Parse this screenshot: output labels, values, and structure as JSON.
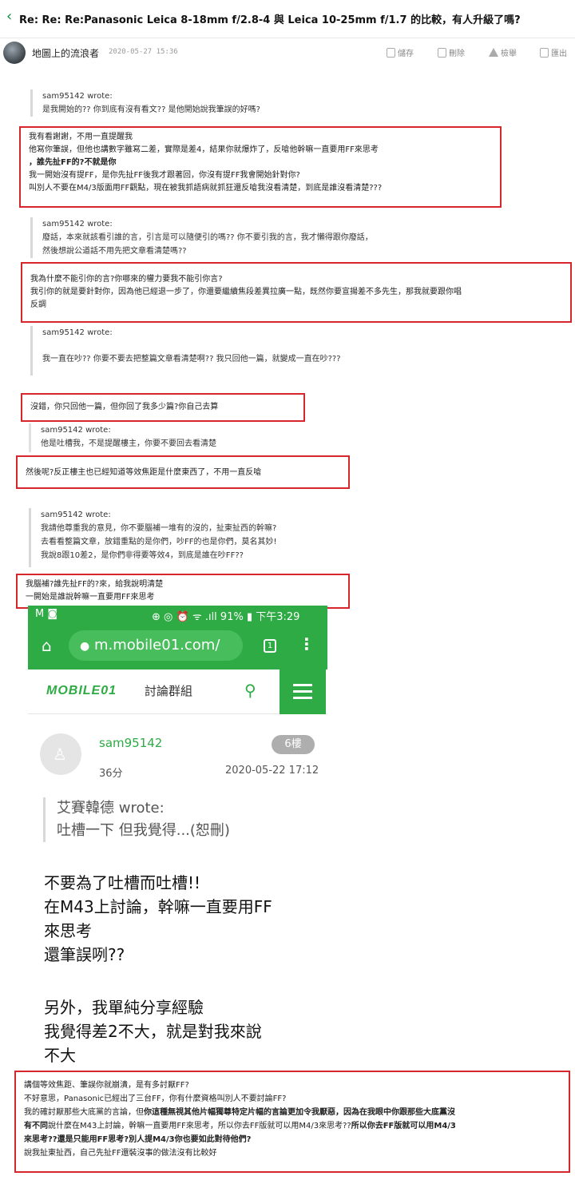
{
  "header": {
    "back_glyph": "‹",
    "title": "Re: Re: Re:Panasonic Leica 8-18mm f/2.8-4 與 Leica 10-25mm f/1.7 的比較，有人升級了嗎?"
  },
  "author": {
    "name": "地圖上的流浪者",
    "time": "2020-05-27 15:36"
  },
  "actions": {
    "save": "儲存",
    "delete": "刪除",
    "report": "檢舉",
    "export": "匯出"
  },
  "quote1": {
    "author": "sam95142 wrote:",
    "text": "是我開始的?? 你到底有沒有看文?? 是他開始說我筆誤的好嗎?"
  },
  "reply1": {
    "line1": "我有看謝謝，不用一直提醒我",
    "line2": "他寫你筆誤，但他也講數字雖寫二差，實際是差4，結果你就爆炸了，反嗆他幹嘛一直要用FF來思考",
    "line3": "，誰先扯FF的?不就是你",
    "line4": "我一開始沒有提FF，是你先扯FF後我才跟著回，你沒有提FF我會開始針對你?",
    "line5": "叫別人不要在M4/3版面用FF觀點，現在被我抓語病就抓狂還反嗆我沒看清楚，到底是誰沒看清楚???"
  },
  "quote2": {
    "author": "sam95142 wrote:",
    "line1": "廢話，本來就該看引誰的言，引言是可以隨便引的嗎?? 你不要引我的言，我才懶得跟你廢話，",
    "line2": "然後想說公道話不用先把文章看清楚嗎??"
  },
  "reply2": {
    "line1": "我為什麼不能引你的言?你哪來的權力要我不能引你言?",
    "line2": "我引你的就是要針對你，因為他已經退一步了，你還要繼續焦段差異拉廣一點，既然你要宣揚差不多先生，那我就要跟你唱",
    "line3": "反調"
  },
  "quote3": {
    "author": "sam95142 wrote:",
    "text": "我一直在吵?? 你要不要去把整篇文章看清楚啊?? 我只回他一篇，就變成一直在吵???"
  },
  "reply3": {
    "text": "沒錯，你只回他一篇，但你回了我多少篇?你自己去算"
  },
  "quote4": {
    "author": "sam95142 wrote:",
    "text": "他是吐槽我，不是提醒樓主，你要不要回去看清楚"
  },
  "reply4": {
    "text": "然後呢?反正樓主也已經知道等效焦距是什麼東西了，不用一直反嗆"
  },
  "quote5": {
    "author": "sam95142 wrote:",
    "line1": "我請他尊重我的意見，你不要腦補一堆有的沒的，扯東扯西的幹嘛?",
    "line2": "去看看整篇文章，放錯重點的是你們，吵FF的也是你們，莫名其妙!",
    "line3": "我說8跟10差2，是你們非得要等效4，到底是誰在吵FF??"
  },
  "reply5": {
    "line1": "我腦補?誰先扯FF的?來，給我說明清楚",
    "line2": "一開始是誰說幹嘛一直要用FF來思考"
  },
  "phone": {
    "status_left": "M ◙",
    "status_right": "⊕ ◎ ⏰ ᯤ .ıll 91% ▮ 下午3:29",
    "url": "m.mobile01.com/",
    "tab_count": "1",
    "logo": "MOBILE01",
    "forum_label": "討論群組",
    "post_user": "sam95142",
    "floor": "6樓",
    "post_age": "36分",
    "post_date": "2020-05-22 17:12",
    "quote_author": "艾賽韓德 wrote:",
    "quote_text": "吐槽一下 但我覺得...(恕刪)",
    "body": [
      "不要為了吐槽而吐槽!!",
      "在M43上討論，幹嘛一直要用FF",
      "來思考",
      "還筆誤咧??",
      "",
      "另外，我單純分享經驗",
      "我覺得差2不大，就是對我來說",
      "不大"
    ]
  },
  "reply6": {
    "line1": "講個等效焦距、筆誤你就崩潰，是有多討厭FF?",
    "line2": "不好意思，Panasonic已經出了三台FF，你有什麼資格叫別人不要討論FF?",
    "line3a": "我的確討厭那些大底黨的言論，但",
    "line3b": "你這種無視其他片幅獨尊特定片幅的言論更加令我厭惡，因為在我眼中你跟那些大底黨沒",
    "line4a": "有不同",
    "line4b": "說什麼在M43上討論，幹嘛一直要用FF來思考，所以你去FF版就可以用M4/3來思考??",
    "line4c": "所以你去FF版就可以用M4/3",
    "line5": "來思考??還是只能用FF思考?別人提M4/3你也要如此對待他們?",
    "line6": "說我扯東扯西，自己先扯FF還裝沒事的做法沒有比較好"
  }
}
